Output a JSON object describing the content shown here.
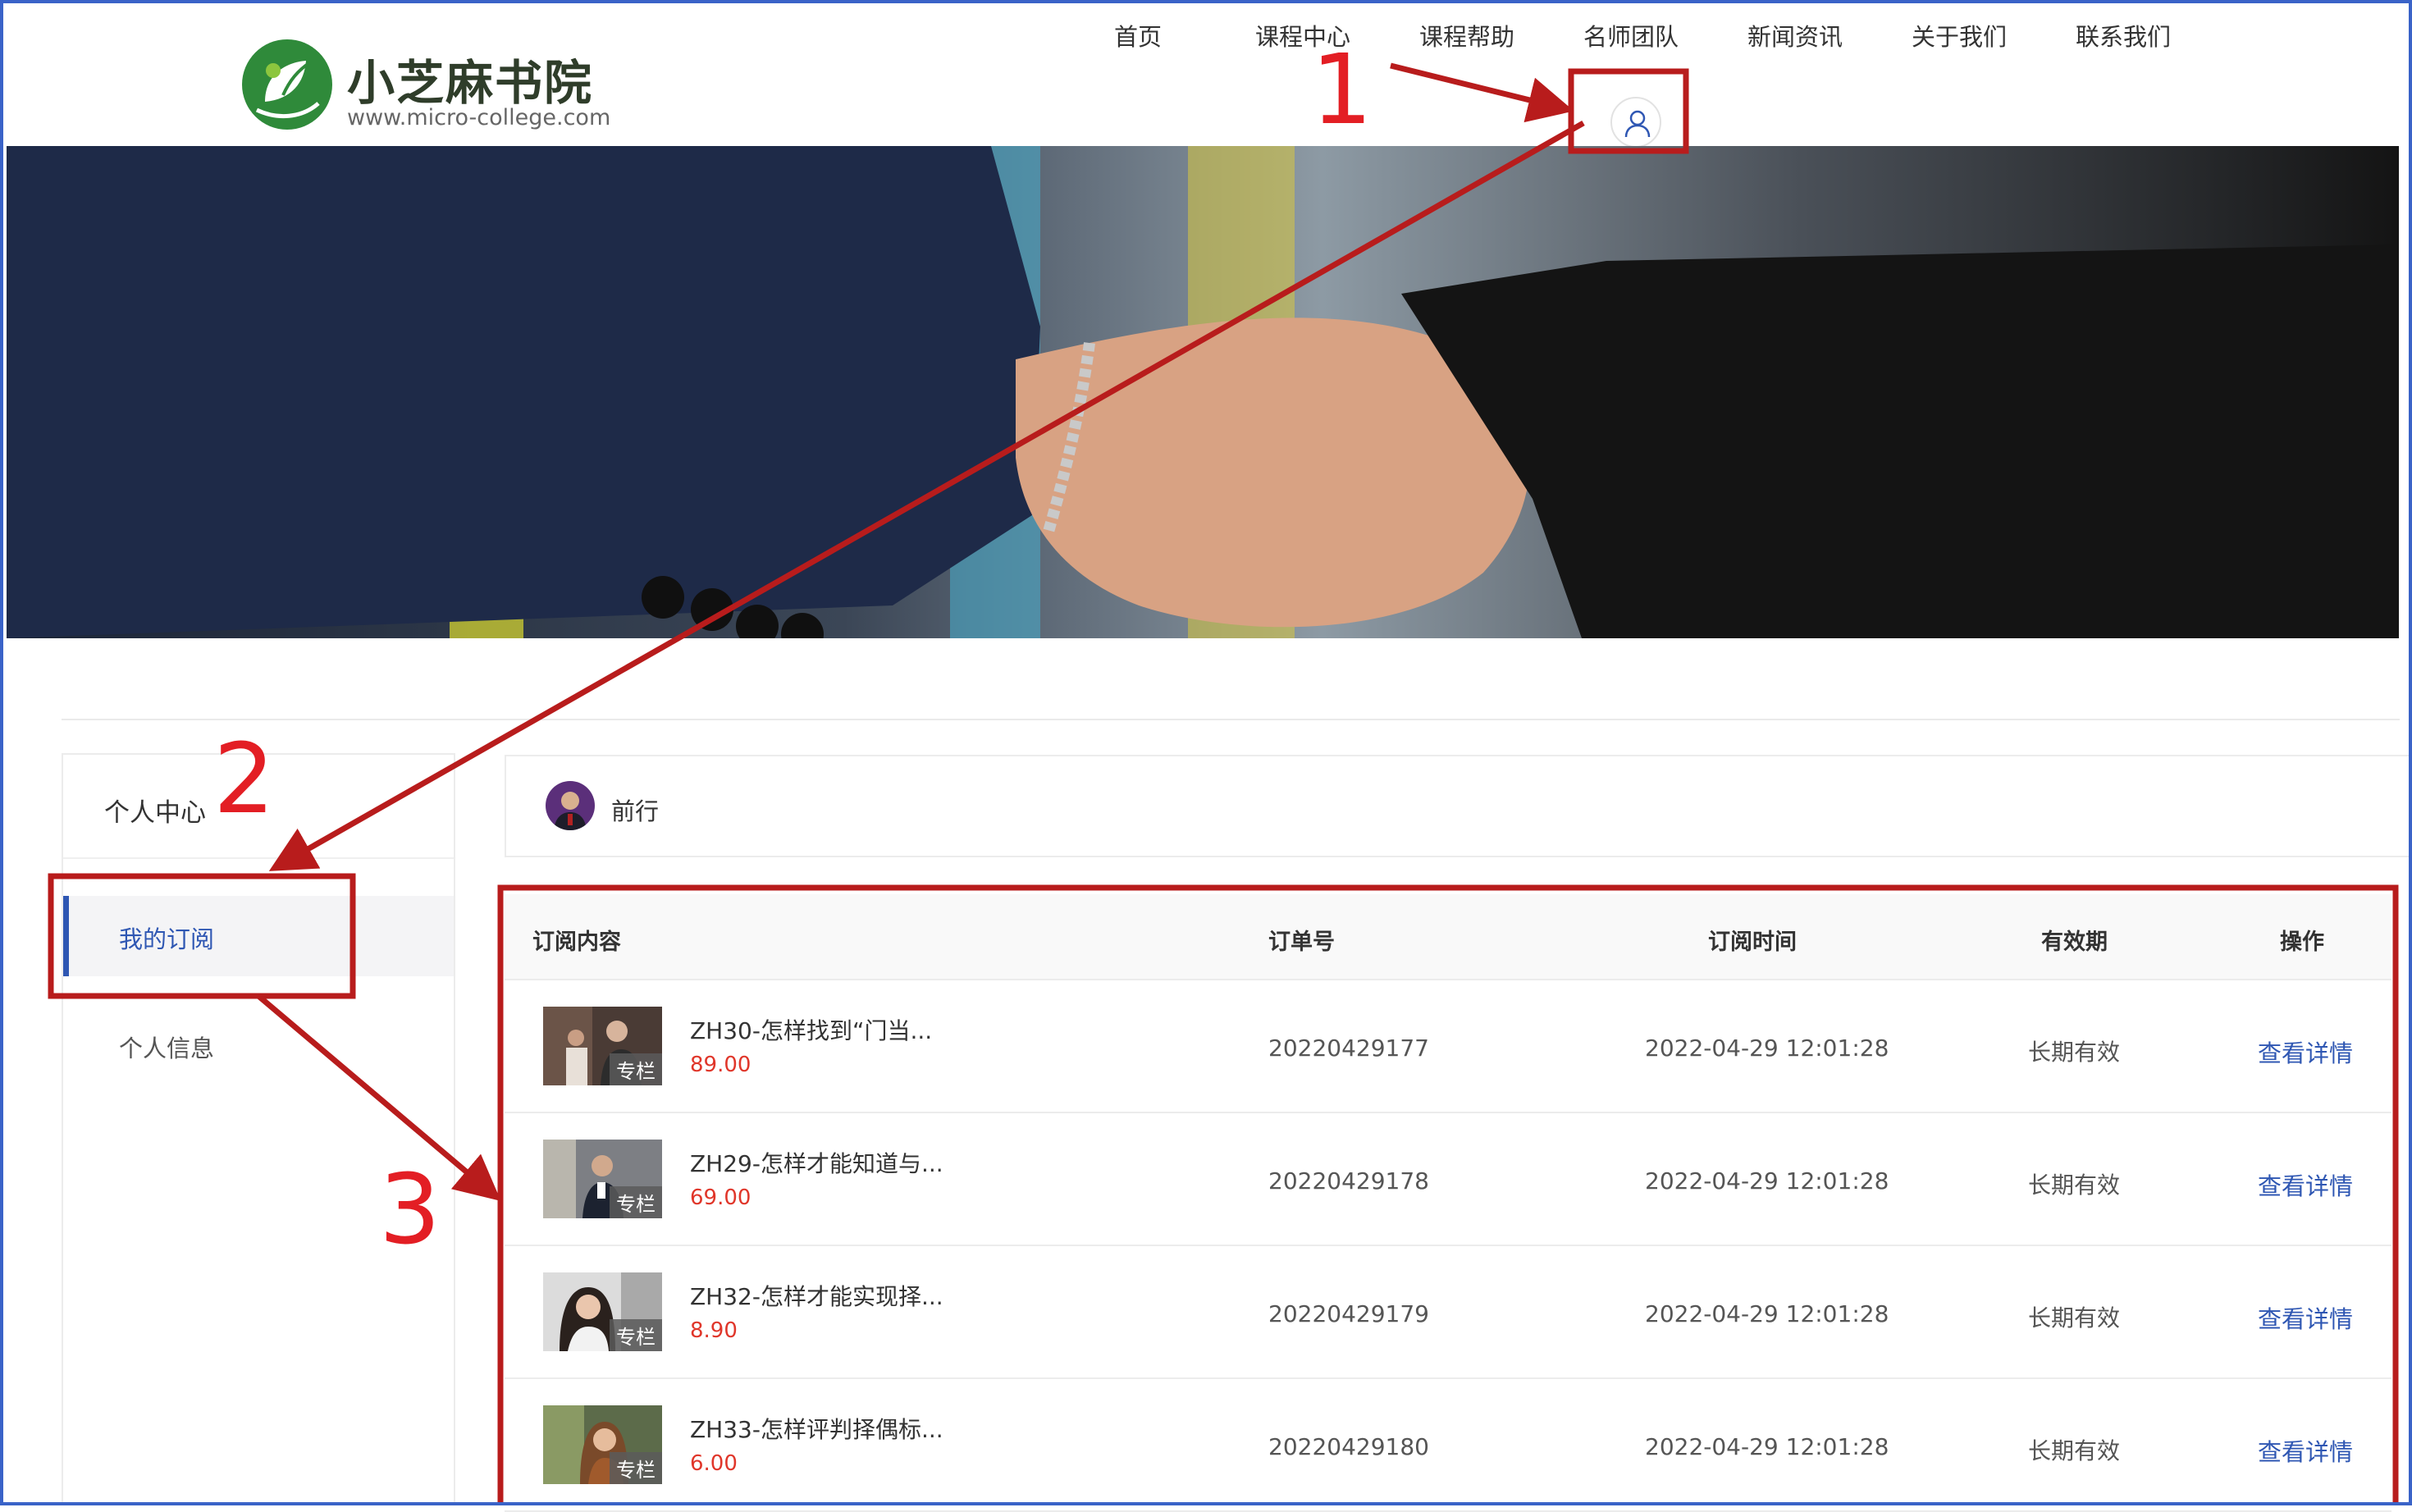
{
  "header": {
    "logo_title": "小芝麻书院",
    "logo_url": "www.micro-college.com",
    "nav": [
      "首页",
      "课程中心",
      "课程帮助",
      "名师团队",
      "新闻资讯",
      "关于我们",
      "联系我们"
    ]
  },
  "sidebar": {
    "title": "个人中心",
    "items": [
      {
        "label": "我的订阅",
        "active": true
      },
      {
        "label": "个人信息",
        "active": false
      }
    ]
  },
  "profile": {
    "name": "前行"
  },
  "table": {
    "headers": [
      "订阅内容",
      "订单号",
      "订阅时间",
      "有效期",
      "操作"
    ],
    "rows": [
      {
        "title": "ZH30-怎样找到“门当...",
        "price": "89.00",
        "tag": "专栏",
        "order": "20220429177",
        "time": "2022-04-29 12:01:28",
        "validity": "长期有效",
        "action": "查看详情"
      },
      {
        "title": "ZH29-怎样才能知道与...",
        "price": "69.00",
        "tag": "专栏",
        "order": "20220429178",
        "time": "2022-04-29 12:01:28",
        "validity": "长期有效",
        "action": "查看详情"
      },
      {
        "title": "ZH32-怎样才能实现择...",
        "price": "8.90",
        "tag": "专栏",
        "order": "20220429179",
        "time": "2022-04-29 12:01:28",
        "validity": "长期有效",
        "action": "查看详情"
      },
      {
        "title": "ZH33-怎样评判择偶标...",
        "price": "6.00",
        "tag": "专栏",
        "order": "20220429180",
        "time": "2022-04-29 12:01:28",
        "validity": "长期有效",
        "action": "查看详情"
      }
    ]
  },
  "annotations": [
    "1",
    "2",
    "3"
  ],
  "colors": {
    "accent": "#2f57b3",
    "price": "#e0362a",
    "annotation": "#b81c1c",
    "frame": "#3a63c8"
  },
  "icons": {
    "user": "user-icon",
    "logo": "leaf-logo-icon"
  }
}
